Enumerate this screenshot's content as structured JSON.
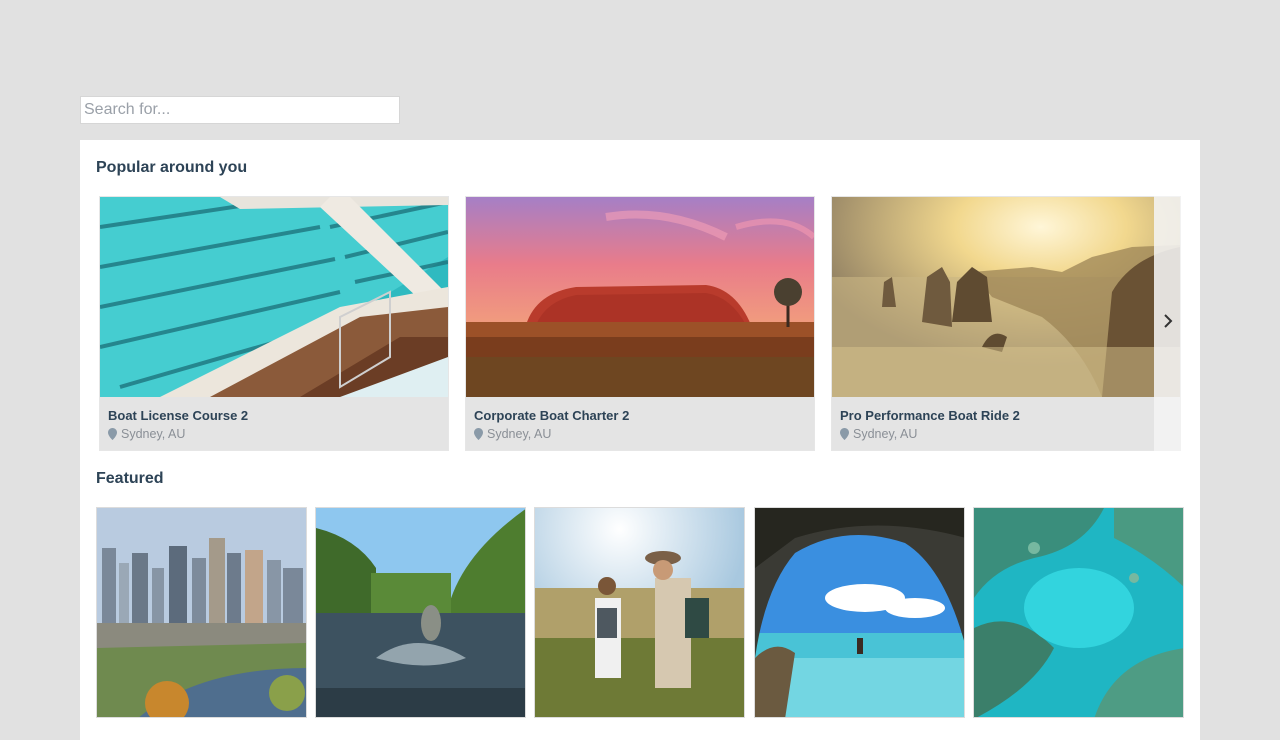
{
  "search": {
    "placeholder": "Search for..."
  },
  "popular": {
    "title": "Popular around you",
    "cards": [
      {
        "title": "Boat License Course 2",
        "location": "Sydney, AU",
        "image": "ocean-pool-photo"
      },
      {
        "title": "Corporate Boat Charter 2",
        "location": "Sydney, AU",
        "image": "uluru-sunset-photo"
      },
      {
        "title": "Pro Performance Boat Ride 2",
        "location": "Sydney, AU",
        "image": "twelve-apostles-photo"
      }
    ],
    "next_icon": "chevron-right-icon"
  },
  "featured": {
    "title": "Featured",
    "tiles": [
      {
        "image": "melbourne-skyline-photo"
      },
      {
        "image": "jumping-fish-river-photo"
      },
      {
        "image": "hikers-photo"
      },
      {
        "image": "sea-cave-beach-photo"
      },
      {
        "image": "aerial-reef-photo"
      }
    ]
  },
  "colors": {
    "background": "#e1e1e1",
    "panel": "#ffffff",
    "heading": "#2d4356",
    "card_footer": "#e4e4e4",
    "muted": "#8a8f96"
  }
}
